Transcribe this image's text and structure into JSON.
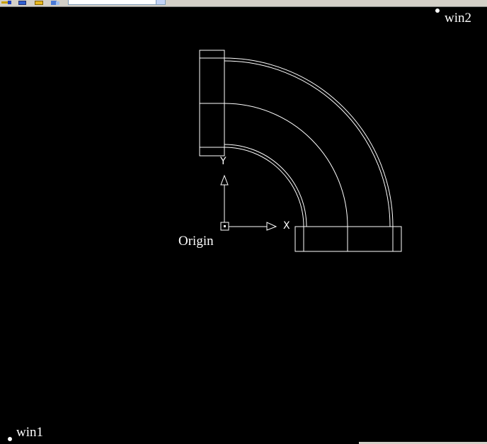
{
  "toolbar": {
    "icons": [
      "match-properties-icon",
      "layer-icon",
      "folder-icon",
      "design-center-icon"
    ],
    "combo_value": ""
  },
  "drawing": {
    "origin_label": "Origin",
    "win1_label": "win1",
    "win2_label": "win2",
    "ucs": {
      "x_label": "X",
      "y_label": "Y"
    },
    "colors": {
      "background": "#000000",
      "lines": "#ffffff"
    }
  }
}
